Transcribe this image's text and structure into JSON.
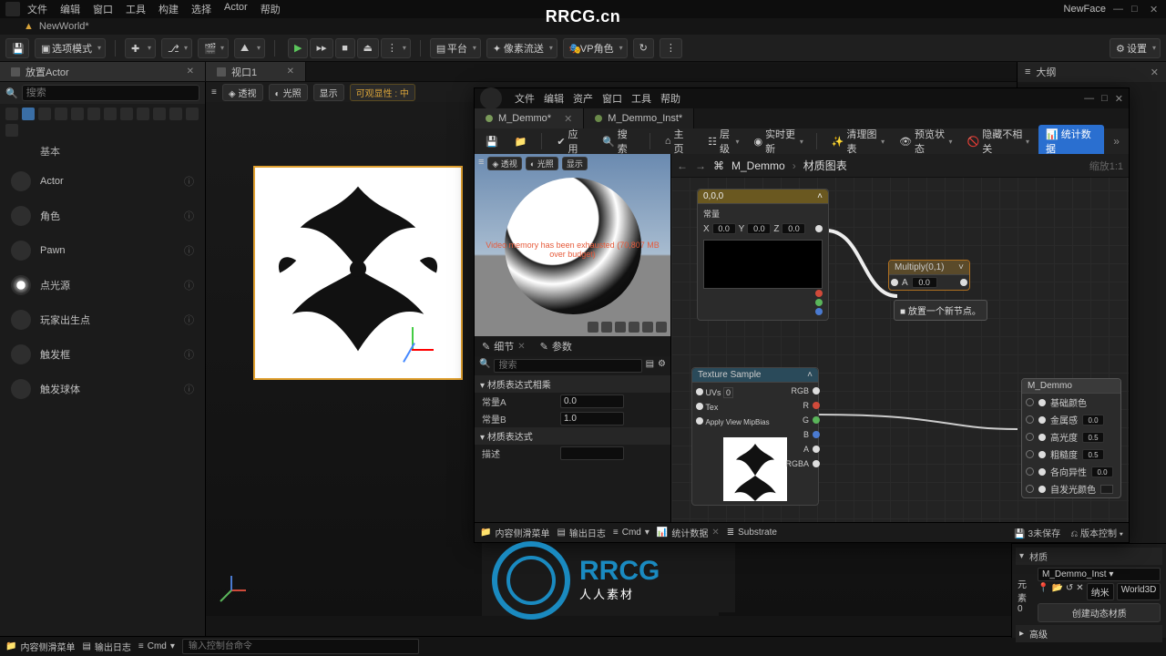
{
  "menu": {
    "file": "文件",
    "edit": "编辑",
    "window": "窗口",
    "tools": "工具",
    "build": "构建",
    "select": "选择",
    "actor": "Actor",
    "help": "帮助"
  },
  "watermark": "RRCG.cn",
  "project_tab": "NewWorld*",
  "top_right_label": "NewFace",
  "toolbar": {
    "mode": "选项模式",
    "platform": "平台",
    "streaming": "像素流送",
    "vpchar": "VP角色",
    "settings": "设置"
  },
  "panels": {
    "placeActors": "放置Actor",
    "viewport": "视口1",
    "outline": "大纲"
  },
  "search_placeholder": "搜索",
  "category_basic": "基本",
  "actors": [
    "Actor",
    "角色",
    "Pawn",
    "点光源",
    "玩家出生点",
    "触发框",
    "触发球体"
  ],
  "viewport_chips": {
    "persp": "透视",
    "lit": "光照",
    "show": "显示",
    "vis": "可观显性 : 中"
  },
  "bottom_tabs": {
    "content": "内容侧滑菜单",
    "output": "输出日志",
    "cmd": "Cmd"
  },
  "cmd_placeholder": "输入控制台命令",
  "mat": {
    "menu": {
      "file": "文件",
      "edit": "编辑",
      "asset": "资产",
      "window": "窗口",
      "tools": "工具",
      "help": "帮助"
    },
    "tabs": {
      "mat": "M_Demmo*",
      "inst": "M_Demmo_Inst*"
    },
    "toolbar": {
      "apply": "应用",
      "search": "搜索",
      "home": "主页",
      "hierarchy": "层级",
      "live": "实时更新",
      "clean": "清理图表",
      "preview": "预览状态",
      "hide": "隐藏不相关",
      "stats": "统计数据"
    },
    "crumb": {
      "name": "M_Demmo",
      "graph": "材质图表",
      "zoom": "缩放1:1"
    },
    "preview_chips": {
      "persp": "透视",
      "lit": "光照",
      "show": "显示"
    },
    "preview_err": "Video memory has been exhausted (70,807 MB over budget)",
    "detail_tabs": {
      "detail": "细节",
      "params": "参数"
    },
    "detail_search": "搜索",
    "group1": "材质表达式相乘",
    "constA": {
      "label": "常量A",
      "value": "0.0"
    },
    "constB": {
      "label": "常量B",
      "value": "1.0"
    },
    "group2": "材质表达式",
    "desc": {
      "label": "描述",
      "value": ""
    },
    "const_node": {
      "title": "0,0,0",
      "vec_label": "常量",
      "x": "0.0",
      "y": "0.0",
      "z": "0.0"
    },
    "mult_node": {
      "title": "Multiply(0,1)",
      "a_label": "A",
      "a_val": "0.0"
    },
    "tooltip": "放置一个新节点。",
    "tex_node": {
      "title": "Texture Sample",
      "uvs": "UVs",
      "uvs_v": "0",
      "tex": "Tex",
      "apply": "Apply View MipBias",
      "rgb": "RGB",
      "r": "R",
      "g": "G",
      "b": "B",
      "a": "A",
      "rgba": "RGBA"
    },
    "result": {
      "title": "M_Demmo",
      "base": "基础颜色",
      "metal": "金属感",
      "metal_v": "0.0",
      "spec": "高光度",
      "spec_v": "0.5",
      "rough": "粗糙度",
      "rough_v": "0.5",
      "aniso": "各向异性",
      "aniso_v": "0.0",
      "emissive": "自发光颜色"
    },
    "bottom": {
      "content": "内容侧滑菜单",
      "output": "输出日志",
      "cmd": "Cmd",
      "stats": "统计数据",
      "substrate": "Substrate",
      "unsaved": "3未保存",
      "version": "版本控制"
    }
  },
  "details": {
    "section_mat": "材质",
    "inst": "M_Demmo_Inst",
    "el_label": "元素0",
    "nanite": "纳米",
    "world": "World3D",
    "create_dyn": "创建动态材质",
    "section_adv": "高级"
  },
  "logo": {
    "big": "RRCG",
    "small": "人人素材"
  }
}
